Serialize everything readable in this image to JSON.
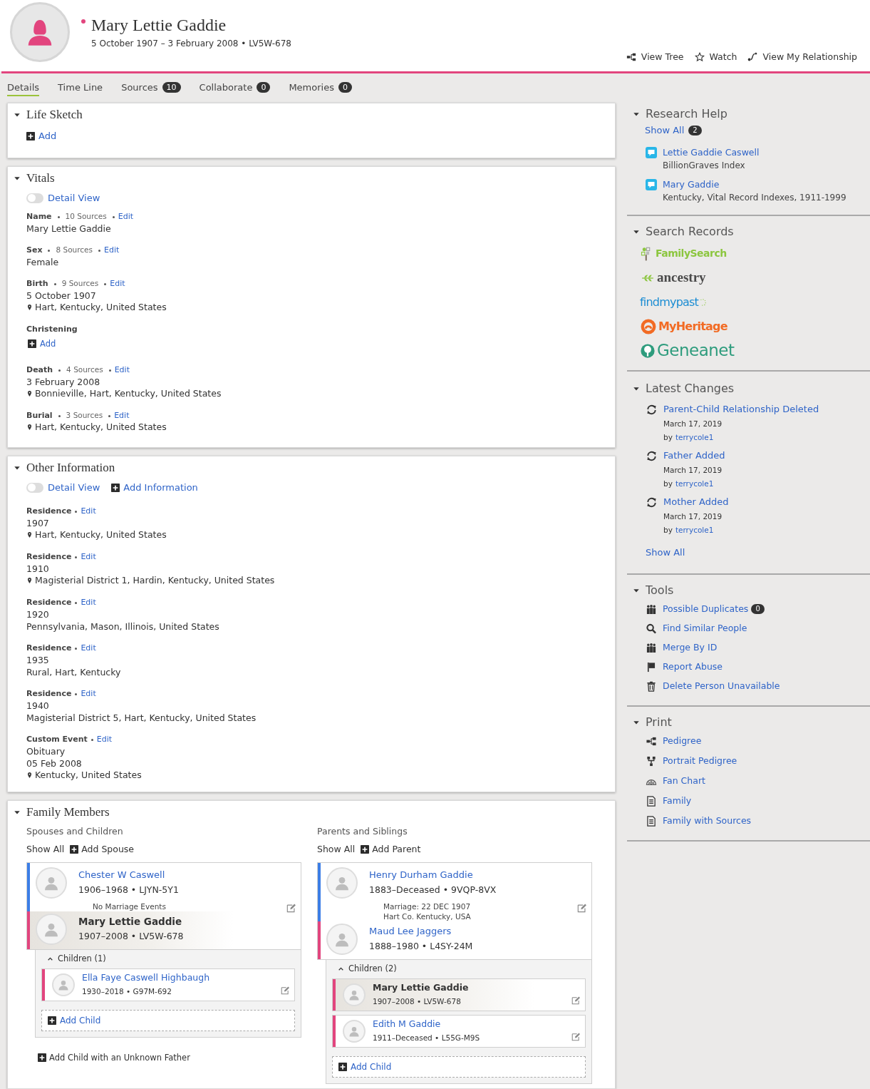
{
  "person": {
    "name": "Mary Lettie Gaddie",
    "color": "#e2457e",
    "summary": "5 October 1907 – 3 February 2008 • LV5W-678"
  },
  "header_actions": [
    {
      "label": "View Tree",
      "kind": "tree"
    },
    {
      "label": "Watch",
      "kind": "star"
    },
    {
      "label": "View My Relationship",
      "kind": "relationship"
    }
  ],
  "tabs": [
    {
      "label": "Details",
      "selected": true
    },
    {
      "label": "Time Line",
      "selected": false
    },
    {
      "label": "Sources",
      "count": "10",
      "selected": false
    },
    {
      "label": "Collaborate",
      "count": "0",
      "selected": false
    },
    {
      "label": "Memories",
      "count": "0",
      "selected": false
    }
  ],
  "life_sketch": {
    "title": "Life Sketch",
    "expanded": true,
    "add": "Add"
  },
  "vitals": {
    "title": "Vitals",
    "expanded": true,
    "toggle": {
      "label": "Detail View",
      "on": false
    },
    "facts": [
      {
        "label": "Name",
        "sources": "10 Sources",
        "edit": "Edit",
        "lines": [
          {
            "kind": "text",
            "text": "Mary Lettie Gaddie"
          }
        ]
      },
      {
        "label": "Sex",
        "sources": "8 Sources",
        "edit": "Edit",
        "lines": [
          {
            "kind": "text",
            "text": "Female"
          }
        ]
      },
      {
        "label": "Birth",
        "sources": "9 Sources",
        "edit": "Edit",
        "lines": [
          {
            "kind": "text",
            "text": "5 October 1907"
          },
          {
            "kind": "place",
            "text": "Hart, Kentucky, United States"
          }
        ]
      },
      {
        "label": "Christening",
        "add": "Add"
      },
      {
        "label": "Death",
        "sources": "4 Sources",
        "edit": "Edit",
        "lines": [
          {
            "kind": "text",
            "text": "3 February 2008"
          },
          {
            "kind": "place",
            "text": "Bonnieville, Hart, Kentucky, United States"
          }
        ]
      },
      {
        "label": "Burial",
        "sources": "3 Sources",
        "edit": "Edit",
        "lines": [
          {
            "kind": "place",
            "text": "Hart, Kentucky, United States"
          }
        ]
      }
    ]
  },
  "other_information": {
    "title": "Other Information",
    "expanded": true,
    "toggle": {
      "label": "Detail View",
      "on": false
    },
    "add": "Add Information",
    "facts": [
      {
        "label": "Residence",
        "edit": "Edit",
        "lines": [
          {
            "kind": "text",
            "text": "1907"
          },
          {
            "kind": "place",
            "text": "Hart, Kentucky, United States"
          }
        ]
      },
      {
        "label": "Residence",
        "edit": "Edit",
        "lines": [
          {
            "kind": "text",
            "text": "1910"
          },
          {
            "kind": "place",
            "text": "Magisterial District 1, Hardin, Kentucky, United States"
          }
        ]
      },
      {
        "label": "Residence",
        "edit": "Edit",
        "lines": [
          {
            "kind": "text",
            "text": "1920"
          },
          {
            "kind": "text",
            "text": "Pennsylvania, Mason, Illinois, United States"
          }
        ]
      },
      {
        "label": "Residence",
        "edit": "Edit",
        "lines": [
          {
            "kind": "text",
            "text": "1935"
          },
          {
            "kind": "text",
            "text": "Rural, Hart, Kentucky"
          }
        ]
      },
      {
        "label": "Residence",
        "edit": "Edit",
        "lines": [
          {
            "kind": "text",
            "text": "1940"
          },
          {
            "kind": "text",
            "text": "Magisterial District 5, Hart, Kentucky, United States"
          }
        ]
      },
      {
        "label": "Custom Event",
        "edit": "Edit",
        "lines": [
          {
            "kind": "text",
            "text": "Obituary"
          },
          {
            "kind": "text",
            "text": "05 Feb 2008"
          },
          {
            "kind": "place",
            "text": "Kentucky, United States"
          }
        ]
      }
    ]
  },
  "family_members": {
    "title": "Family Members",
    "expanded": true,
    "groups": [
      {
        "title": "Spouses and Children",
        "show_all": "Show All",
        "add": "Add Spouse",
        "couple": [
          {
            "name": "Chester W Caswell",
            "details": "1906–1968 • LJYN-5Y1",
            "color": "#3c7ee6",
            "current": false
          },
          {
            "name": "Mary Lettie Gaddie",
            "details": "1907–2008 • LV5W-678",
            "color": "#e2457e",
            "current": true
          }
        ],
        "marriage": [
          "No Marriage Events"
        ],
        "children_label": "Children (1)",
        "children_expanded": true,
        "children": [
          {
            "name": "Ella Faye Caswell Highbaugh",
            "details": "1930–2018 • G97M-692",
            "color": "#e2457e",
            "current": false
          }
        ],
        "add_child": "Add Child",
        "extra_add": "Add Child with an Unknown Father"
      },
      {
        "title": "Parents and Siblings",
        "show_all": "Show All",
        "add": "Add Parent",
        "couple": [
          {
            "name": "Henry Durham Gaddie",
            "details": "1883–Deceased • 9VQP-8VX",
            "color": "#3c7ee6",
            "current": false
          },
          {
            "name": "Maud Lee Jaggers",
            "details": "1888–1980 • L4SY-24M",
            "color": "#e2457e",
            "current": false
          }
        ],
        "marriage": [
          "Marriage: 22 DEC 1907",
          "Hart Co. Kentucky, USA"
        ],
        "children_label": "Children (2)",
        "children_expanded": true,
        "children": [
          {
            "name": "Mary Lettie Gaddie",
            "details": "1907–2008 • LV5W-678",
            "color": "#e2457e",
            "current": true
          },
          {
            "name": "Edith M Gaddie",
            "details": "1911–Deceased • L55G-M9S",
            "color": "#e2457e",
            "current": false
          }
        ],
        "add_child": "Add Child"
      }
    ]
  },
  "sidebar": {
    "research_help": {
      "title": "Research Help",
      "expanded": true,
      "show_all": "Show All",
      "count": "2",
      "items": [
        {
          "title": "Lettie Gaddie Caswell",
          "source": "BillionGraves Index"
        },
        {
          "title": "Mary Gaddie",
          "source": "Kentucky, Vital Record Indexes, 1911-1999"
        }
      ]
    },
    "search_records": {
      "title": "Search Records",
      "expanded": true,
      "sites": [
        {
          "kind": "familysearch",
          "text": "FamilySearch"
        },
        {
          "kind": "ancestry",
          "text": "ancestry"
        },
        {
          "kind": "findmypast",
          "text": "findmypast"
        },
        {
          "kind": "myheritage",
          "text": "MyHeritage"
        },
        {
          "kind": "geneanet",
          "text": "Geneanet"
        }
      ]
    },
    "latest_changes": {
      "title": "Latest Changes",
      "expanded": true,
      "show_all": "Show All",
      "items": [
        {
          "title": "Parent-Child Relationship Deleted",
          "date": "March 17, 2019",
          "by": "by",
          "user": "terrycole1"
        },
        {
          "title": "Father Added",
          "date": "March 17, 2019",
          "by": "by",
          "user": "terrycole1"
        },
        {
          "title": "Mother Added",
          "date": "March 17, 2019",
          "by": "by",
          "user": "terrycole1"
        }
      ]
    },
    "tools": {
      "title": "Tools",
      "expanded": true,
      "items": [
        {
          "label": "Possible Duplicates",
          "kind": "people",
          "count": "0"
        },
        {
          "label": "Find Similar People",
          "kind": "search"
        },
        {
          "label": "Merge By ID",
          "kind": "people"
        },
        {
          "label": "Report Abuse",
          "kind": "flag"
        },
        {
          "label": "Delete Person Unavailable",
          "kind": "trash"
        }
      ]
    },
    "print": {
      "title": "Print",
      "expanded": true,
      "items": [
        {
          "label": "Pedigree",
          "kind": "pedigree"
        },
        {
          "label": "Portrait Pedigree",
          "kind": "portrait"
        },
        {
          "label": "Fan Chart",
          "kind": "fan"
        },
        {
          "label": "Family",
          "kind": "document"
        },
        {
          "label": "Family with Sources",
          "kind": "document"
        }
      ]
    }
  }
}
